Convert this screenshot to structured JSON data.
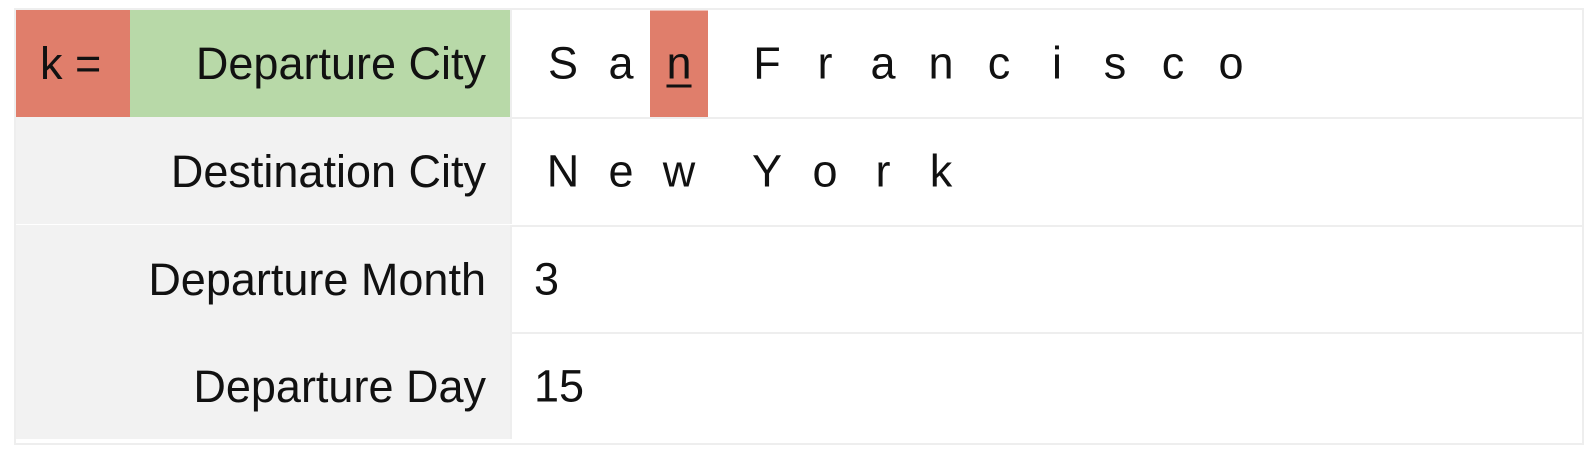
{
  "k_label": "k =",
  "rows": [
    {
      "label": "Departure City",
      "chars": [
        "S",
        "a",
        "n",
        " ",
        "F",
        "r",
        "a",
        "n",
        "c",
        "i",
        "s",
        "c",
        "o"
      ],
      "highlight_index": 2
    },
    {
      "label": "Destination City",
      "chars": [
        "N",
        "e",
        "w",
        " ",
        "Y",
        "o",
        "r",
        "k"
      ],
      "highlight_index": -1
    },
    {
      "label": "Departure Month",
      "value": "3"
    },
    {
      "label": "Departure Day",
      "value": "15"
    }
  ],
  "colors": {
    "highlight": "#e07e6b",
    "active_label": "#b8d9a8",
    "label_bg": "#f2f2f2"
  }
}
